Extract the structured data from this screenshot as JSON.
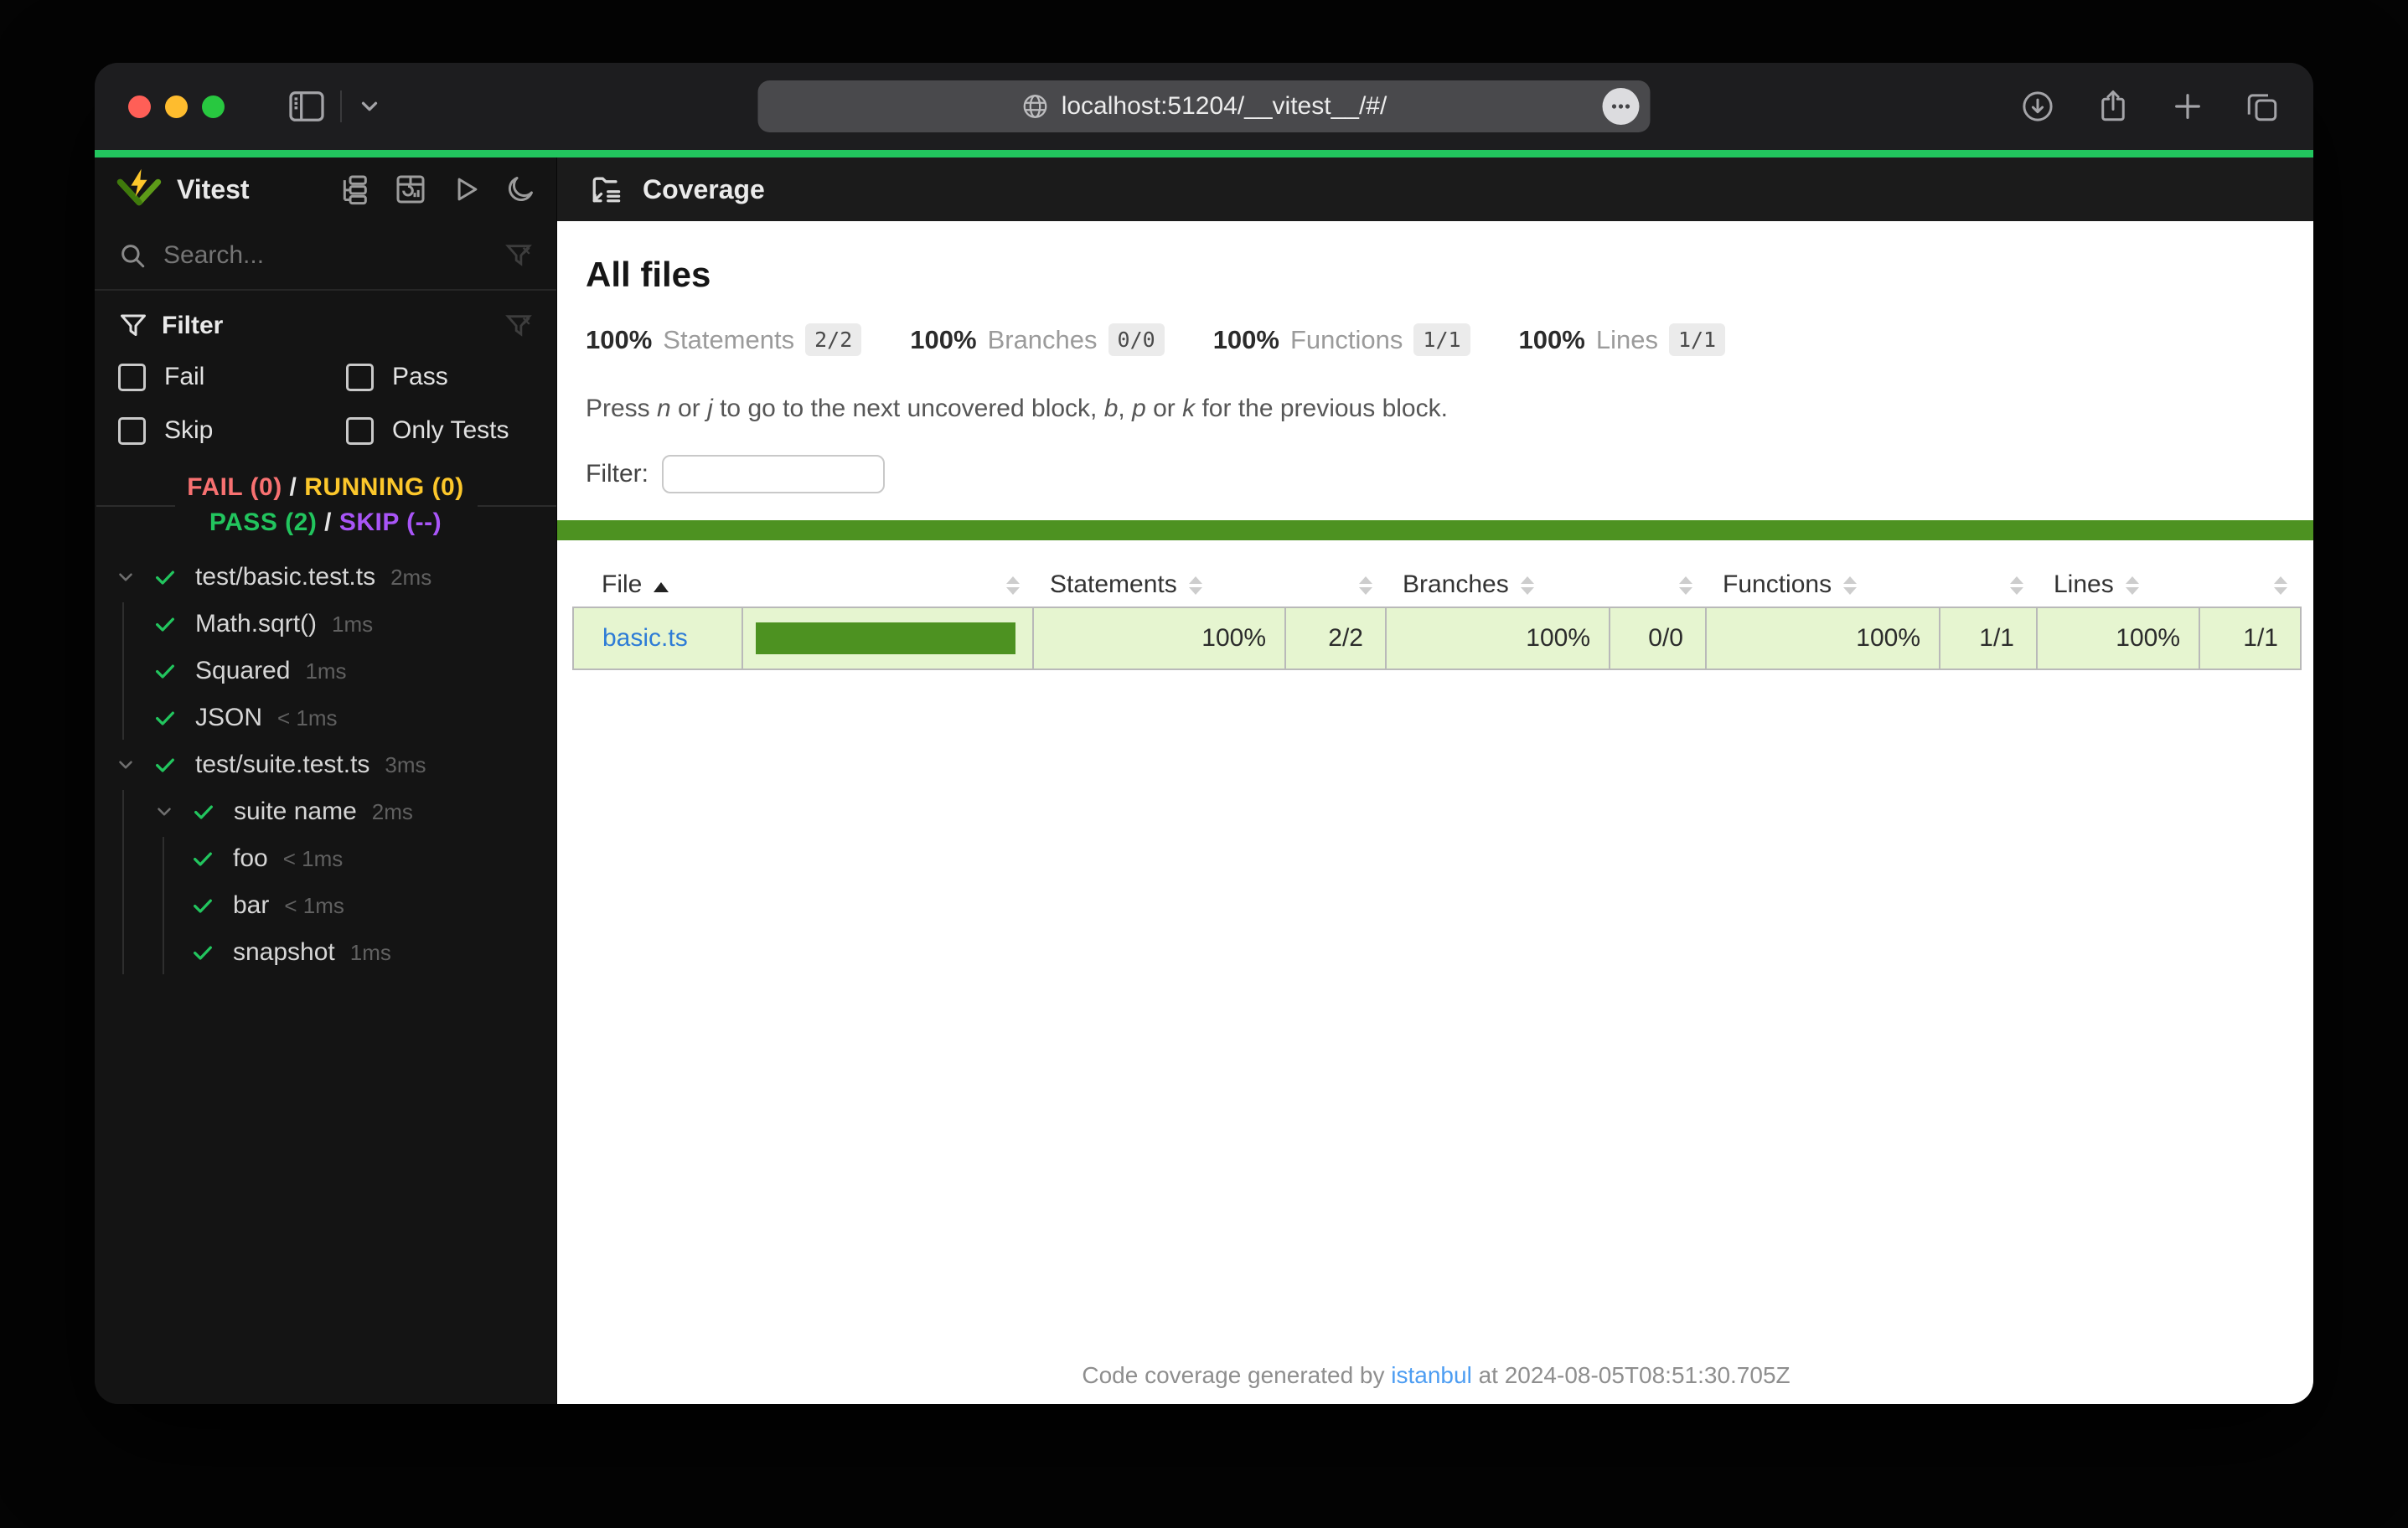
{
  "browser": {
    "url": "localhost:51204/__vitest__/#/",
    "more_glyph": "•••"
  },
  "sidebar": {
    "title": "Vitest",
    "search": {
      "placeholder": "Search..."
    },
    "filter": {
      "title": "Filter",
      "options": [
        "Fail",
        "Pass",
        "Skip",
        "Only Tests"
      ]
    },
    "status": {
      "fail": "FAIL (0)",
      "sep1": " / ",
      "running": "RUNNING (0)",
      "pass": "PASS (2)",
      "sep2": " / ",
      "skip": "SKIP (--)"
    },
    "tree": [
      {
        "label": "test/basic.test.ts",
        "duration": "2ms"
      },
      {
        "label": "Math.sqrt()",
        "duration": "1ms"
      },
      {
        "label": "Squared",
        "duration": "1ms"
      },
      {
        "label": "JSON",
        "duration": "< 1ms"
      },
      {
        "label": "test/suite.test.ts",
        "duration": "3ms"
      },
      {
        "label": "suite name",
        "duration": "2ms"
      },
      {
        "label": "foo",
        "duration": "< 1ms"
      },
      {
        "label": "bar",
        "duration": "< 1ms"
      },
      {
        "label": "snapshot",
        "duration": "1ms"
      }
    ]
  },
  "main": {
    "header_title": "Coverage",
    "page_title": "All files",
    "stats": [
      {
        "pct": "100%",
        "label": "Statements",
        "frac": "2/2"
      },
      {
        "pct": "100%",
        "label": "Branches",
        "frac": "0/0"
      },
      {
        "pct": "100%",
        "label": "Functions",
        "frac": "1/1"
      },
      {
        "pct": "100%",
        "label": "Lines",
        "frac": "1/1"
      }
    ],
    "hint": {
      "s0": "Press ",
      "s1": "n",
      "s2": " or ",
      "s3": "j",
      "s4": " to go to the next uncovered block, ",
      "s5": "b",
      "s6": ", ",
      "s7": "p",
      "s8": " or ",
      "s9": "k",
      "s10": " for the previous block."
    },
    "filter_label": "Filter:",
    "table": {
      "headers": {
        "file": "File",
        "statements": "Statements",
        "branches": "Branches",
        "functions": "Functions",
        "lines": "Lines"
      },
      "rows": [
        {
          "file": "basic.ts",
          "bar_fill_pct": 100,
          "statements_pct": "100%",
          "statements_frac": "2/2",
          "branches_pct": "100%",
          "branches_frac": "0/0",
          "functions_pct": "100%",
          "functions_frac": "1/1",
          "lines_pct": "100%",
          "lines_frac": "1/1"
        }
      ]
    },
    "footer": {
      "prefix": "Code coverage generated by ",
      "link_label": "istanbul",
      "suffix": " at 2024-08-05T08:51:30.705Z"
    }
  },
  "colors": {
    "progress_top": "#22c55e",
    "coverage_green": "#4d9221",
    "coverage_row_bg": "#e6f5d0",
    "fail": "#f87171",
    "running": "#fcc72b",
    "pass": "#22c55e",
    "skip": "#a855f7",
    "file_link": "#2e7cd6",
    "footer_link": "#4d9df2",
    "traffic_close": "#ff5f57",
    "traffic_minimize": "#febc2e",
    "traffic_zoom": "#28c840"
  }
}
